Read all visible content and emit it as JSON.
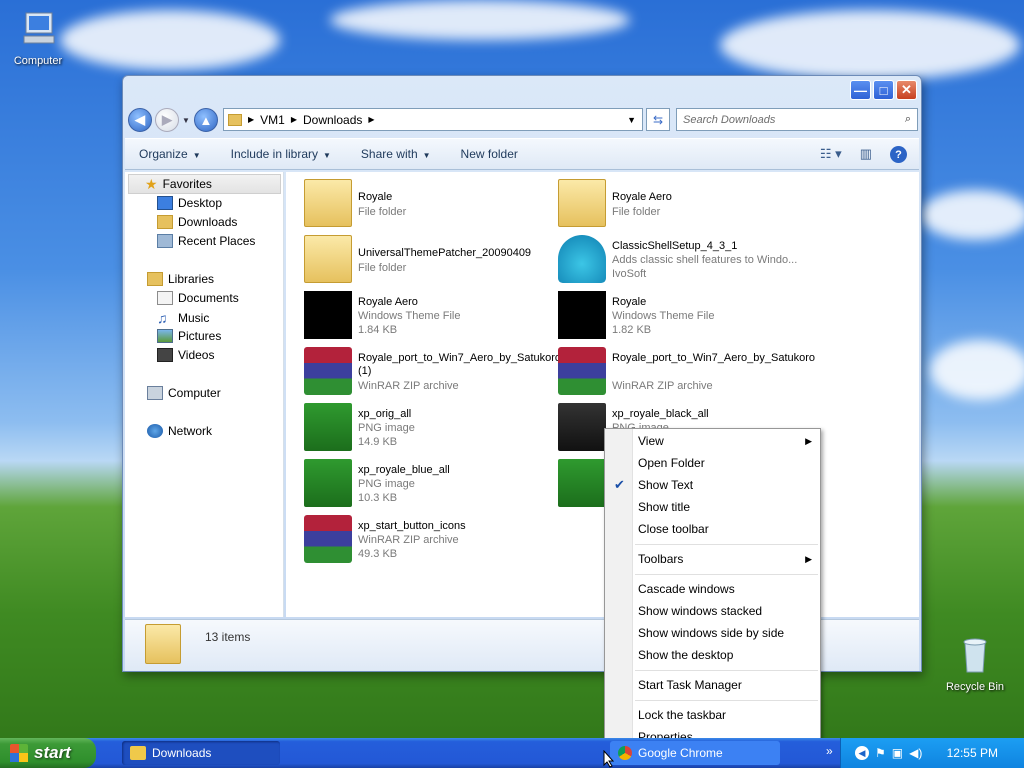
{
  "desktop": {
    "icons": [
      {
        "label": "Computer"
      },
      {
        "label": "Recycle Bin"
      }
    ]
  },
  "window": {
    "caption_buttons": {
      "minimize": "—",
      "maximize": "□",
      "close": "✕"
    },
    "address": {
      "crumbs": [
        "VM1",
        "Downloads"
      ],
      "search_placeholder": "Search Downloads"
    },
    "command_bar": {
      "organize": "Organize",
      "include_in_library": "Include in library",
      "share_with": "Share with",
      "new_folder": "New folder"
    },
    "nav": {
      "favorites": "Favorites",
      "desktop": "Desktop",
      "downloads": "Downloads",
      "recent_places": "Recent Places",
      "libraries": "Libraries",
      "documents": "Documents",
      "music": "Music",
      "pictures": "Pictures",
      "videos": "Videos",
      "computer": "Computer",
      "network": "Network"
    },
    "files": [
      {
        "name": "Royale",
        "type": "File folder",
        "size": "",
        "icon": "folder"
      },
      {
        "name": "Royale Aero",
        "type": "File folder",
        "size": "",
        "icon": "folder"
      },
      {
        "name": "UniversalThemePatcher_20090409",
        "type": "File folder",
        "size": "",
        "icon": "folder"
      },
      {
        "name": "ClassicShellSetup_4_3_1",
        "type": "Adds classic shell features to Windo...",
        "size": "IvoSoft",
        "icon": "shell"
      },
      {
        "name": "Royale Aero",
        "type": "Windows Theme File",
        "size": "1.84 KB",
        "icon": "theme"
      },
      {
        "name": "Royale",
        "type": "Windows Theme File",
        "size": "1.82 KB",
        "icon": "theme"
      },
      {
        "name": "Royale_port_to_Win7_Aero_by_Satukoro (1)",
        "type": "WinRAR ZIP archive",
        "size": "",
        "icon": "rar"
      },
      {
        "name": "Royale_port_to_Win7_Aero_by_Satukoro",
        "type": "WinRAR ZIP archive",
        "size": "",
        "icon": "rar"
      },
      {
        "name": "xp_orig_all",
        "type": "PNG image",
        "size": "14.9 KB",
        "icon": "png"
      },
      {
        "name": "xp_royale_black_all",
        "type": "PNG image",
        "size": "",
        "icon": "png-black"
      },
      {
        "name": "xp_royale_blue_all",
        "type": "PNG image",
        "size": "10.3 KB",
        "icon": "png"
      },
      {
        "name": "",
        "type": "",
        "size": "",
        "icon": "png"
      },
      {
        "name": "xp_start_button_icons",
        "type": "WinRAR ZIP archive",
        "size": "49.3 KB",
        "icon": "rar"
      }
    ],
    "details": {
      "count": "13 items"
    }
  },
  "context_menu": {
    "items": [
      {
        "label": "View",
        "submenu": true,
        "checked": false
      },
      {
        "label": "Open Folder",
        "submenu": false,
        "checked": false
      },
      {
        "label": "Show Text",
        "submenu": false,
        "checked": true
      },
      {
        "label": "Show title",
        "submenu": false,
        "checked": false
      },
      {
        "label": "Close toolbar",
        "submenu": false,
        "checked": false
      },
      {
        "label": "Toolbars",
        "submenu": true,
        "checked": false
      },
      {
        "label": "Cascade windows",
        "submenu": false,
        "checked": false
      },
      {
        "label": "Show windows stacked",
        "submenu": false,
        "checked": false
      },
      {
        "label": "Show windows side by side",
        "submenu": false,
        "checked": false
      },
      {
        "label": "Show the desktop",
        "submenu": false,
        "checked": false
      },
      {
        "label": "Start Task Manager",
        "submenu": false,
        "checked": false
      },
      {
        "label": "Lock the taskbar",
        "submenu": false,
        "checked": false
      },
      {
        "label": "Properties",
        "submenu": false,
        "checked": false
      }
    ]
  },
  "taskbar": {
    "start_label": "start",
    "buttons": [
      {
        "label": "Downloads"
      },
      {
        "label": "Google Chrome"
      }
    ],
    "clock": "12:55 PM",
    "overflow": "»"
  },
  "colors": {
    "taskbar_blue": "#245edb",
    "start_green": "#3c9a37",
    "tray_blue": "#0f84e0"
  }
}
